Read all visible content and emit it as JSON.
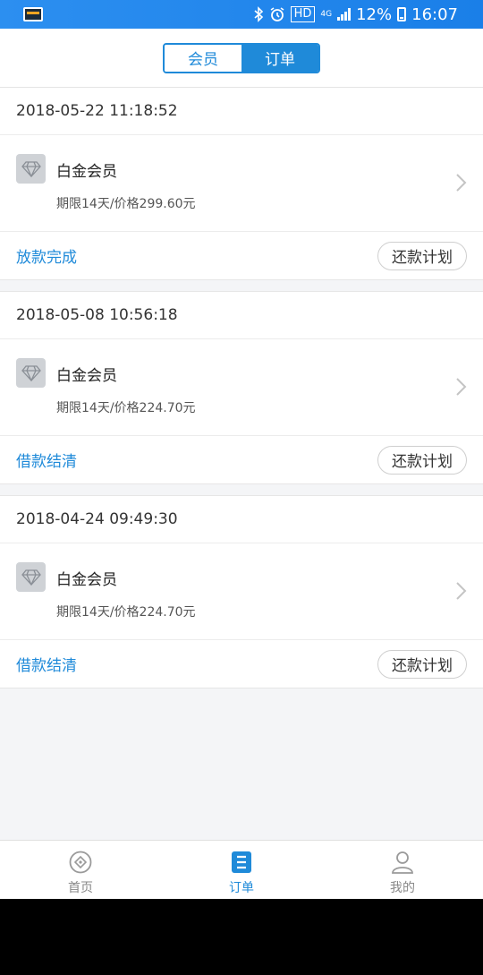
{
  "status_bar": {
    "hd": "HD",
    "network": "4G",
    "battery": "12%",
    "time": "16:07"
  },
  "header": {
    "tabs": [
      {
        "label": "会员",
        "active": false
      },
      {
        "label": "订单",
        "active": true
      }
    ]
  },
  "orders": [
    {
      "date": "2018-05-22 11:18:52",
      "name": "白金会员",
      "desc": "期限14天/价格299.60元",
      "status": "放款完成",
      "plan_label": "还款计划"
    },
    {
      "date": "2018-05-08 10:56:18",
      "name": "白金会员",
      "desc": "期限14天/价格224.70元",
      "status": "借款结清",
      "plan_label": "还款计划"
    },
    {
      "date": "2018-04-24 09:49:30",
      "name": "白金会员",
      "desc": "期限14天/价格224.70元",
      "status": "借款结清",
      "plan_label": "还款计划"
    }
  ],
  "tabbar": {
    "items": [
      {
        "label": "首页",
        "icon": "compass-icon",
        "active": false
      },
      {
        "label": "订单",
        "icon": "order-list-icon",
        "active": true
      },
      {
        "label": "我的",
        "icon": "user-icon",
        "active": false
      }
    ]
  },
  "colors": {
    "accent": "#1f8ad9",
    "statusbar": "#1a7fe8"
  }
}
